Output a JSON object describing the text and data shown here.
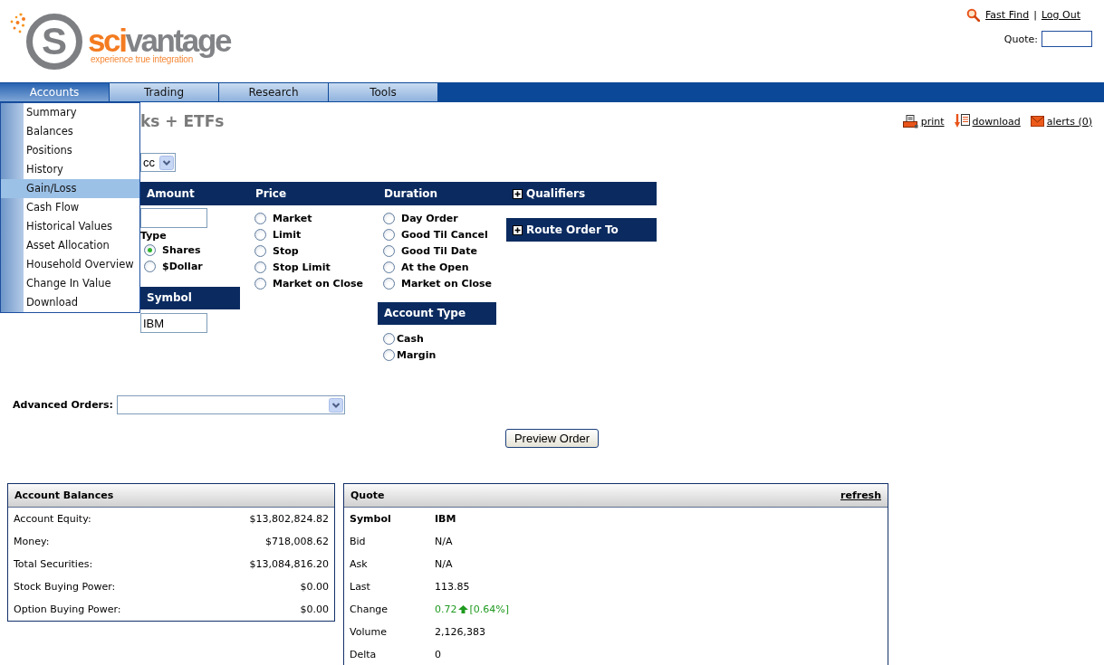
{
  "logo": {
    "emblem_letter": "S",
    "wordmark_accent": "sci",
    "wordmark_rest": "vantage",
    "tagline": "experience true integration"
  },
  "top_links": [
    {
      "kind": "fast_find",
      "label": "Fast Find"
    },
    {
      "kind": "log_out",
      "label": "Log Out"
    }
  ],
  "top_links_separator": "|",
  "quote_lookup": {
    "label": "Quote:"
  },
  "nav": {
    "tabs": [
      {
        "label": "Accounts",
        "selected": true
      },
      {
        "label": "Trading",
        "selected": false
      },
      {
        "label": "Research",
        "selected": false
      },
      {
        "label": "Tools",
        "selected": false
      }
    ]
  },
  "accounts_menu": {
    "items": [
      {
        "label": "Summary",
        "selected": false
      },
      {
        "label": "Balances",
        "selected": false
      },
      {
        "label": "Positions",
        "selected": false
      },
      {
        "label": "History",
        "selected": false
      },
      {
        "label": "Gain/Loss",
        "selected": true
      },
      {
        "label": "Cash Flow",
        "selected": false
      },
      {
        "label": "Historical Values",
        "selected": false
      },
      {
        "label": "Asset Allocation",
        "selected": false
      },
      {
        "label": "Household Overview",
        "selected": false
      },
      {
        "label": "Change In Value",
        "selected": false
      },
      {
        "label": "Download",
        "selected": false
      }
    ]
  },
  "page": {
    "title": "ks + ETFs",
    "actions": [
      {
        "kind": "print",
        "label": "print"
      },
      {
        "kind": "download",
        "label": "download"
      },
      {
        "kind": "alerts",
        "label": "alerts (0)"
      }
    ]
  },
  "account_select": {
    "value": "cc"
  },
  "order_form": {
    "amount": {
      "heading": "Amount",
      "type_label": "Type",
      "types": [
        {
          "label": "Shares",
          "selected": true
        },
        {
          "label": "$Dollar",
          "selected": false
        }
      ]
    },
    "symbol": {
      "heading": "Symbol",
      "value": "IBM"
    },
    "price": {
      "heading": "Price",
      "options": [
        {
          "label": "Market",
          "selected": false
        },
        {
          "label": "Limit",
          "selected": false
        },
        {
          "label": "Stop",
          "selected": false
        },
        {
          "label": "Stop Limit",
          "selected": false
        },
        {
          "label": "Market on Close",
          "selected": false
        }
      ]
    },
    "duration": {
      "heading": "Duration",
      "options": [
        {
          "label": "Day Order",
          "selected": false
        },
        {
          "label": "Good Til Cancel",
          "selected": false
        },
        {
          "label": "Good Til Date",
          "selected": false
        },
        {
          "label": "At the Open",
          "selected": false
        },
        {
          "label": "Market on Close",
          "selected": false
        }
      ]
    },
    "account_type": {
      "heading": "Account Type",
      "options": [
        {
          "label": "Cash",
          "selected": false
        },
        {
          "label": "Margin",
          "selected": false
        }
      ]
    },
    "qualifiers": {
      "heading": "Qualifiers",
      "expanded": false
    },
    "route_order_to": {
      "heading": "Route Order To",
      "expanded": false
    }
  },
  "advanced_orders": {
    "label": "Advanced Orders:"
  },
  "preview_button": "Preview Order",
  "account_balances": {
    "title": "Account Balances",
    "rows": [
      {
        "label": "Account Equity:",
        "value": "$13,802,824.82"
      },
      {
        "label": "Money:",
        "value": "$718,008.62"
      },
      {
        "label": "Total Securities:",
        "value": "$13,084,816.20"
      },
      {
        "label": "Stock Buying Power:",
        "value": "$0.00"
      },
      {
        "label": "Option Buying Power:",
        "value": "$0.00"
      }
    ]
  },
  "quote": {
    "title": "Quote",
    "refresh": "refresh",
    "rows": [
      {
        "kind": "heading",
        "label": "Symbol",
        "value": "IBM"
      },
      {
        "kind": "plain",
        "label": "Bid",
        "value": "N/A"
      },
      {
        "kind": "plain",
        "label": "Ask",
        "value": "N/A"
      },
      {
        "kind": "plain",
        "label": "Last",
        "value": "113.85"
      },
      {
        "kind": "change",
        "label": "Change",
        "value": "0.72",
        "rising": true,
        "suffix": "[0.64%]"
      },
      {
        "kind": "plain",
        "label": "Volume",
        "value": "2,126,383"
      },
      {
        "kind": "plain",
        "label": "Delta",
        "value": "0"
      }
    ]
  }
}
